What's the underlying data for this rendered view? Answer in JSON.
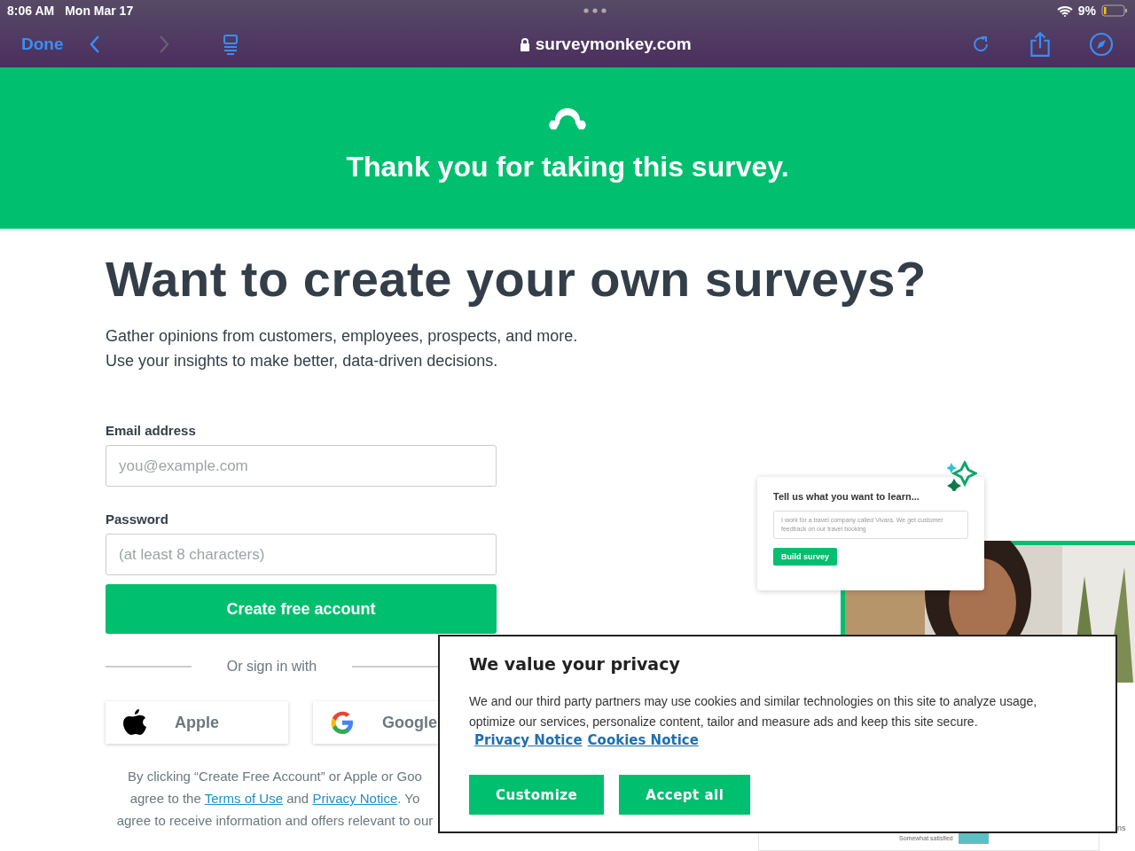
{
  "status_bar": {
    "time": "8:06 AM",
    "date": "Mon Mar 17",
    "battery": "9%"
  },
  "browser": {
    "done": "Done",
    "url": "surveymonkey.com"
  },
  "banner": {
    "title": "Thank you for taking this survey."
  },
  "promo": {
    "heading": "Want to create your own surveys?",
    "lines": [
      "Gather opinions from customers, employees, prospects, and more.",
      "Use your insights to make better, data-driven decisions."
    ]
  },
  "form": {
    "email_label": "Email address",
    "email_placeholder": "you@example.com",
    "password_label": "Password",
    "password_placeholder": "(at least 8 characters)",
    "submit": "Create free account",
    "divider": "Or sign in with",
    "providers": [
      {
        "kind": "apple",
        "label": "Apple"
      },
      {
        "kind": "google",
        "label": "Google"
      }
    ],
    "legal": [
      {
        "text": "By clicking “Create Free Account” or Apple or Goo"
      },
      {
        "text": "agree to the ",
        "links": [
          "Terms of Use",
          "Privacy Notice"
        ],
        "joiner": " and ",
        "tail": ". Yo"
      },
      {
        "text": "agree to receive information and offers relevant to our"
      }
    ]
  },
  "illustration": {
    "card_title": "Tell us what you want to learn...",
    "card_text": "I work for a travel company called Vivara. We get customer feedback on our travel booking",
    "card_button": "Build survey",
    "chart_label": "Somewhat satisfied",
    "edge_text": "ns"
  },
  "cookie_dialog": {
    "title": "We value your privacy",
    "body": "We and our third party partners may use cookies and similar technologies on this site to analyze usage, optimize our services, personalize content, tailor and measure ads and keep this site secure.",
    "links": [
      "Privacy Notice",
      "Cookies Notice"
    ],
    "buttons": [
      "Customize",
      "Accept all"
    ]
  }
}
